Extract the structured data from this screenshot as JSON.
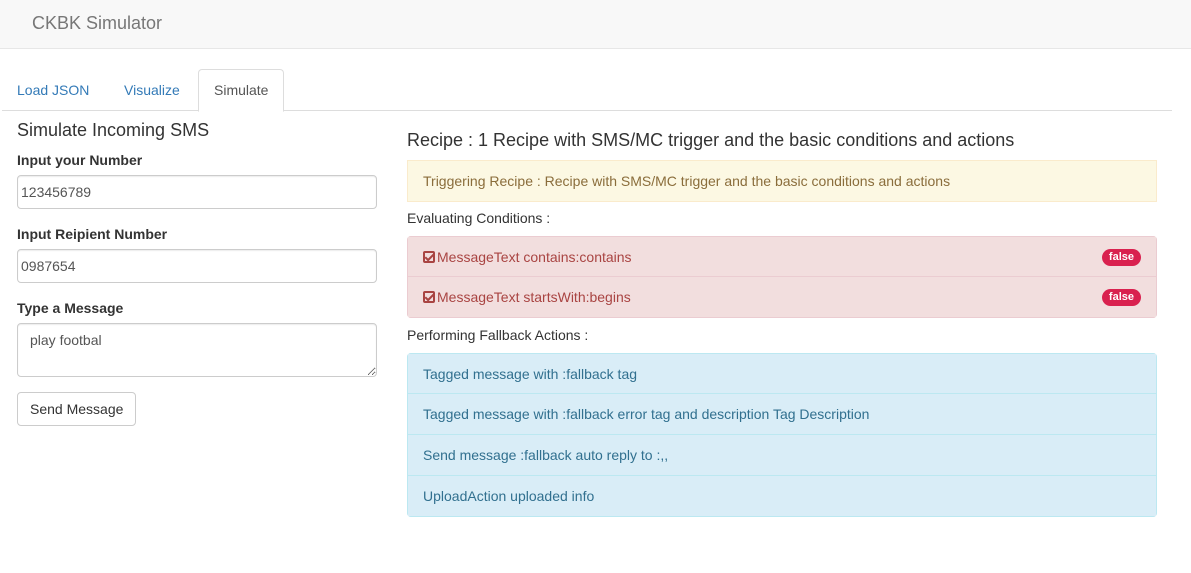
{
  "app": {
    "title": "CKBK Simulator"
  },
  "tabs": [
    {
      "label": "Load JSON",
      "active": false
    },
    {
      "label": "Visualize",
      "active": false
    },
    {
      "label": "Simulate",
      "active": true
    }
  ],
  "form": {
    "title": "Simulate Incoming SMS",
    "number_label": "Input your Number",
    "number_value": "123456789",
    "recipient_label": "Input Reipient Number",
    "recipient_value": "0987654",
    "message_label": "Type a Message",
    "message_value": "play footbal",
    "send_label": "Send Message"
  },
  "recipe": {
    "title": "Recipe : 1 Recipe with SMS/MC trigger and the basic conditions and actions",
    "triggering": "Triggering Recipe : Recipe with SMS/MC trigger and the basic conditions and actions",
    "conditions_label": "Evaluating Conditions :",
    "conditions": [
      {
        "text": "MessageText contains:contains",
        "result": "false"
      },
      {
        "text": "MessageText startsWith:begins",
        "result": "false"
      }
    ],
    "fallback_label": "Performing Fallback Actions :",
    "actions": [
      "Tagged message with :fallback tag",
      "Tagged message with :fallback error tag and description Tag Description",
      "Send message :fallback auto reply to :,,",
      "UploadAction uploaded info"
    ]
  },
  "colors": {
    "danger_bg": "#f2dede",
    "danger_text": "#a94442",
    "info_bg": "#d9edf7",
    "info_text": "#31708f",
    "warning_bg": "#fcf8e3",
    "warning_text": "#8a6d3b",
    "badge": "#d9214f",
    "link": "#337ab7"
  }
}
